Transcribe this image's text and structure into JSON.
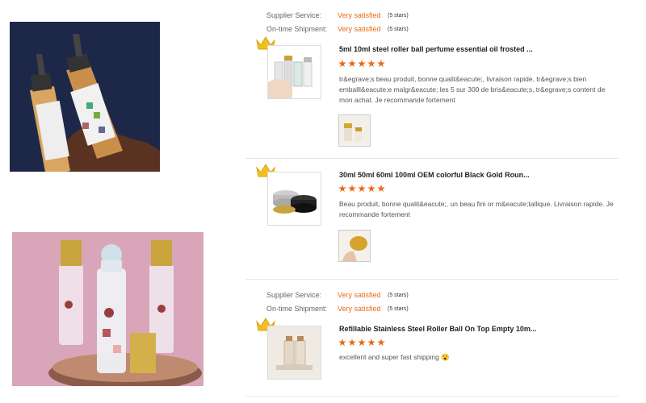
{
  "meta_labels": {
    "supplier": "Supplier Service:",
    "shipment": "On-time Shipment:"
  },
  "reviews": [
    {
      "supplier_value": "Very satisfied",
      "supplier_stars": "(5 stars)",
      "shipment_value": "Very satisfied",
      "shipment_stars": "(5 stars)",
      "title": "5ml 10ml steel roller ball perfume essential oil frosted ...",
      "rating": 5,
      "text": "tr&egrave;s beau produit, bonne qualit&eacute;, livraison rapide, tr&egrave;s bien emballl&eacute;e malgr&eacute; les 5 sur 300 de bris&eacute;s, tr&egrave;s content de mon achat. Je recommande fortement"
    },
    {
      "title": "30ml 50ml 60ml 100ml OEM colorful Black Gold Roun...",
      "rating": 5,
      "text": "Beau produit, bonne qualit&eacute;, un beau fini or m&eacute;tallique. Livraison rapide. Je recommande fortement"
    },
    {
      "supplier_value": "Very satisfied",
      "supplier_stars": "(5 stars)",
      "shipment_value": "Very satisfied",
      "shipment_stars": "(5 stars)",
      "title": "Refillable Stainless Steel Roller Ball On Top Empty 10m...",
      "rating": 5,
      "text": "excellent and super fast shipping 😮"
    }
  ],
  "colors": {
    "accent": "#e86a17",
    "crown": "#f2c01d"
  },
  "icons": [
    "crown-icon",
    "star-icon",
    "surprised-face-icon"
  ]
}
